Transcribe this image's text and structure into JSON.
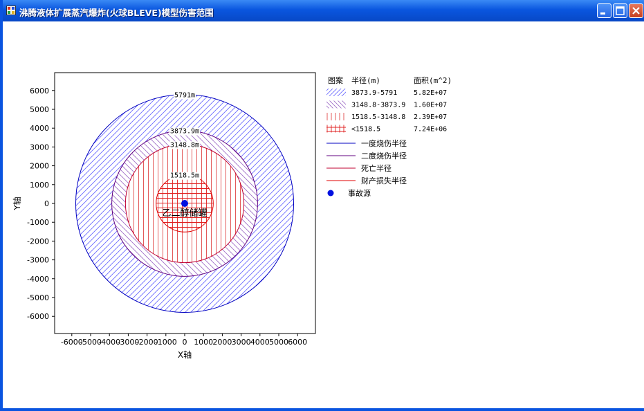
{
  "window": {
    "title": "沸腾液体扩展蒸汽爆炸(火球BLEVE)模型伤害范围"
  },
  "legend": {
    "header_pattern": "图案",
    "header_radius": "半径(m)",
    "header_area": "面积(m^2)",
    "zones": [
      {
        "range": "3873.9-5791",
        "area": "5.82E+07",
        "color": "#6060ff"
      },
      {
        "range": "3148.8-3873.9",
        "area": "1.60E+07",
        "color": "#9a60c0"
      },
      {
        "range": "1518.5-3148.8",
        "area": "2.39E+07",
        "color": "#d83030"
      },
      {
        "range": "<1518.5",
        "area": "7.24E+06",
        "color": "#e00000"
      }
    ],
    "lines": [
      {
        "label": "一度烧伤半径",
        "color": "#0000c0"
      },
      {
        "label": "二度烧伤半径",
        "color": "#600080"
      },
      {
        "label": "死亡半径",
        "color": "#c00030"
      },
      {
        "label": "财产损失半径",
        "color": "#e00000"
      }
    ],
    "source_label": "事故源",
    "source_color": "#0010e0"
  },
  "chart_data": {
    "type": "scatter",
    "xlabel": "X轴",
    "ylabel": "Y轴",
    "xlim": [
      -7000,
      7000
    ],
    "ylim": [
      -7000,
      7000
    ],
    "xticks": [
      -6000,
      -5000,
      -4000,
      -3000,
      -2000,
      -1000,
      0,
      1000,
      2000,
      3000,
      4000,
      5000,
      6000
    ],
    "yticks": [
      6000,
      5000,
      4000,
      3000,
      2000,
      1000,
      0,
      -1000,
      -2000,
      -3000,
      -4000,
      -5000,
      -6000
    ],
    "circles": [
      {
        "radius": 5791,
        "label": "5791m",
        "color": "#0000c0"
      },
      {
        "radius": 3873.9,
        "label": "3873.9m",
        "color": "#600080"
      },
      {
        "radius": 3148.8,
        "label": "3148.8m",
        "color": "#c00030"
      },
      {
        "radius": 1518.5,
        "label": "1518.5m",
        "color": "#e00000"
      }
    ],
    "source": {
      "x": 0,
      "y": 0,
      "label": "乙二醇储罐"
    }
  }
}
